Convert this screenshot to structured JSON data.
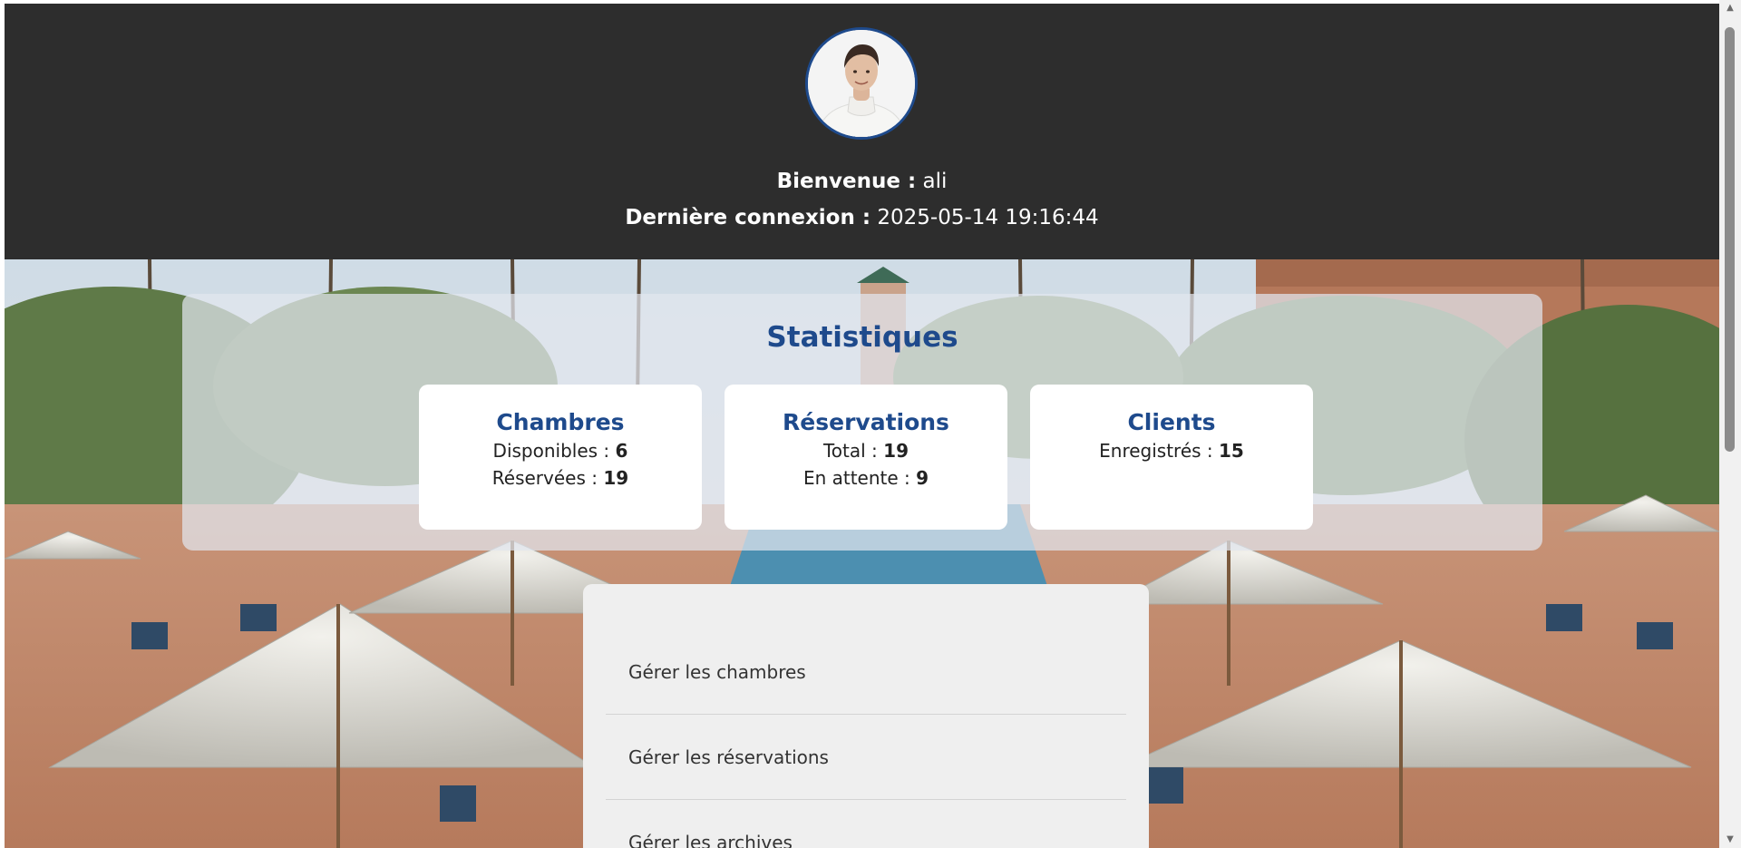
{
  "header": {
    "welcome_label": "Bienvenue :",
    "username": "ali",
    "last_login_label": "Dernière connexion :",
    "last_login_value": "2025-05-14 19:16:44"
  },
  "stats": {
    "title": "Statistiques",
    "cards": [
      {
        "title": "Chambres",
        "lines": [
          {
            "label": "Disponibles :",
            "value": "6"
          },
          {
            "label": "Réservées :",
            "value": "19"
          }
        ]
      },
      {
        "title": "Réservations",
        "lines": [
          {
            "label": "Total :",
            "value": "19"
          },
          {
            "label": "En attente :",
            "value": "9"
          }
        ]
      },
      {
        "title": "Clients",
        "lines": [
          {
            "label": "Enregistrés :",
            "value": "15"
          }
        ]
      }
    ]
  },
  "menu": {
    "items": [
      {
        "label": "Gérer les chambres"
      },
      {
        "label": "Gérer les réservations"
      },
      {
        "label": "Gérer les archives"
      }
    ]
  },
  "colors": {
    "header_bg": "#2d2d2d",
    "accent": "#1e4a8c",
    "card_bg": "#ffffff",
    "menu_bg": "#efefef"
  },
  "icons": {
    "avatar": "user-avatar",
    "scroll_up": "arrow-up-icon",
    "scroll_down": "arrow-down-icon"
  }
}
